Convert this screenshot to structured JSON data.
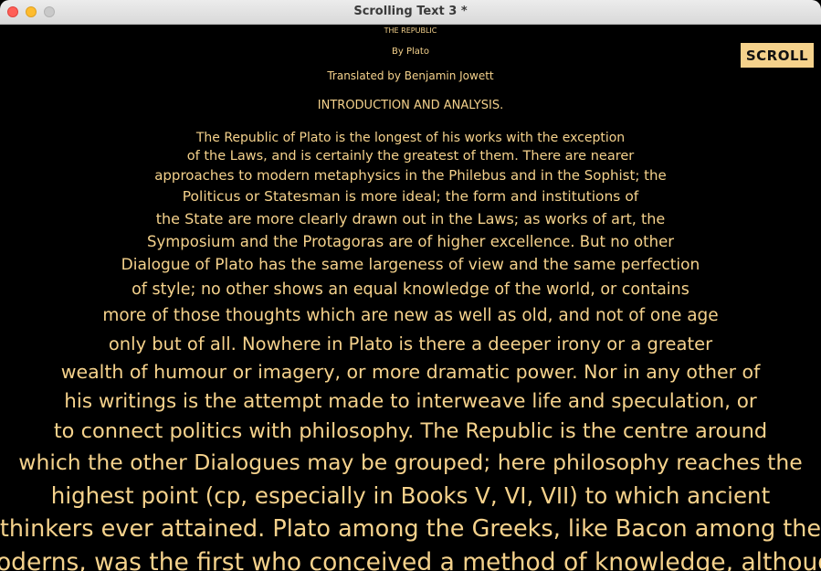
{
  "window": {
    "title": "Scrolling Text 3 *"
  },
  "scroll_button": {
    "label": "SCROLL"
  },
  "header": {
    "book_title": "THE REPUBLIC",
    "author": "By Plato",
    "translator": "Translated by Benjamin Jowett",
    "section": "INTRODUCTION AND ANALYSIS."
  },
  "body_lines": [
    "The Republic of Plato is the longest of his works with the exception",
    "of the Laws, and is certainly the greatest of them. There are nearer",
    "approaches to modern metaphysics in the Philebus and in the Sophist; the",
    "Politicus or Statesman is more ideal; the form and institutions of",
    "the State are more clearly drawn out in the Laws; as works of art, the",
    "Symposium and the Protagoras are of higher excellence. But no other",
    "Dialogue of Plato has the same largeness of view and the same perfection",
    "of style; no other shows an equal knowledge of the world, or contains",
    "more of those thoughts which are new as well as old, and not of one age",
    "only but of all. Nowhere in Plato is there a deeper irony or a greater",
    "wealth of humour or imagery, or more dramatic power. Nor in any other of",
    "his writings is the attempt made to interweave life and speculation, or",
    "to connect politics with philosophy. The Republic is the centre around",
    "which the other Dialogues may be grouped; here philosophy reaches the",
    "highest point (cp, especially in Books V, VI, VII) to which ancient",
    "thinkers ever attained. Plato among the Greeks, like Bacon among the",
    "moderns, was the first who conceived a method of knowledge, although"
  ],
  "colors": {
    "text": "#f5d28c",
    "background": "#000000",
    "button": "#f5d28c"
  }
}
